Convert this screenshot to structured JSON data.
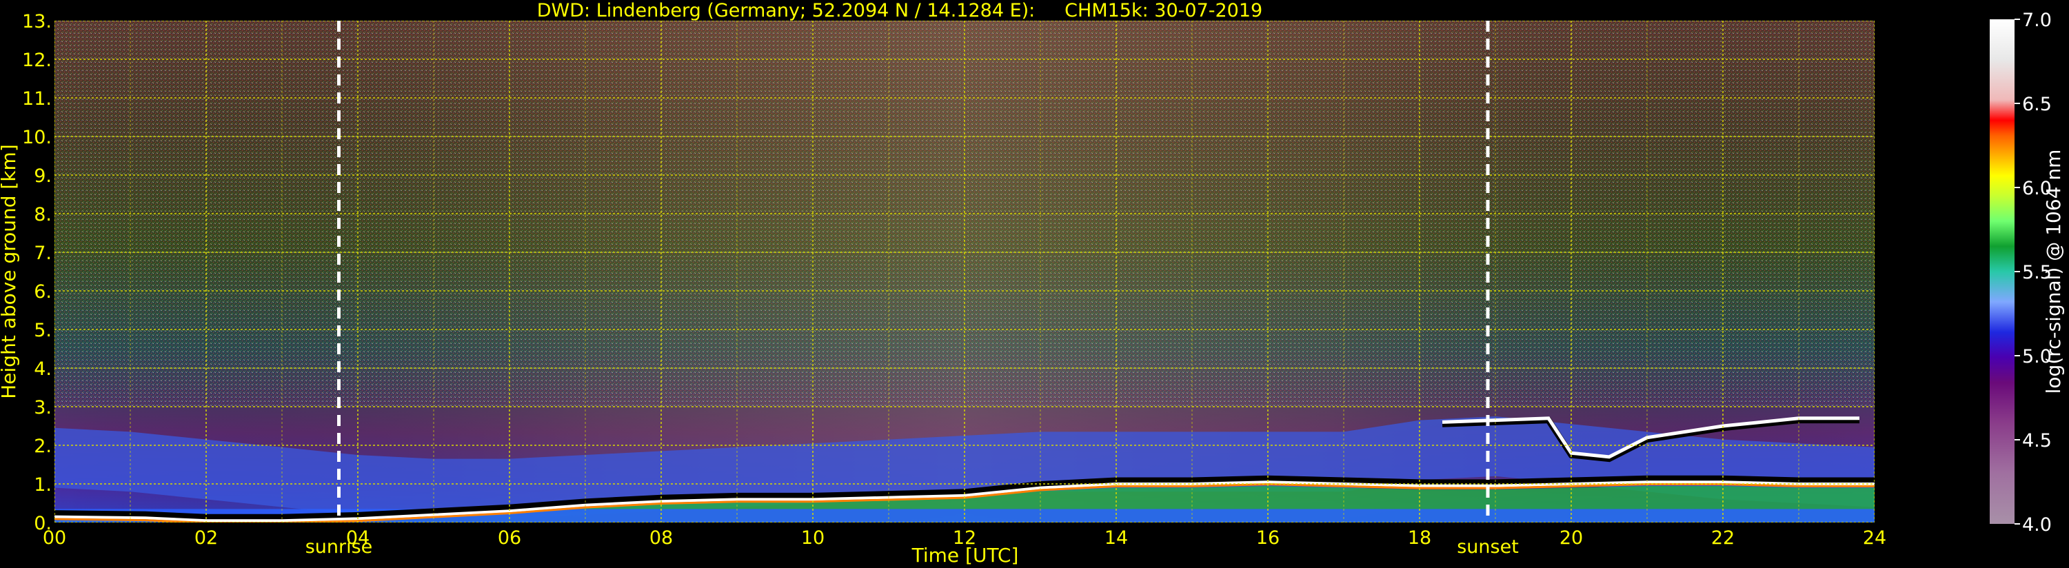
{
  "chart_data": {
    "type": "heatmap",
    "title": "DWD: Lindenberg (Germany; 52.2094 N / 14.1284 E):     CHM15k: 30-07-2019",
    "xlabel": "Time [UTC]",
    "ylabel": "Height above ground [km]",
    "xlim": [
      0,
      24
    ],
    "ylim": [
      0,
      13
    ],
    "x_ticks": [
      0,
      2,
      4,
      6,
      8,
      10,
      12,
      14,
      16,
      18,
      20,
      22,
      24
    ],
    "x_tick_labels": [
      "00",
      "02",
      "04",
      "06",
      "08",
      "10",
      "12",
      "14",
      "16",
      "18",
      "20",
      "22",
      "24"
    ],
    "y_ticks": [
      0,
      1,
      2,
      3,
      4,
      5,
      6,
      7,
      8,
      9,
      10,
      11,
      12,
      13
    ],
    "y_tick_labels": [
      "0.",
      "1.",
      "2.",
      "3.",
      "4.",
      "5.",
      "6.",
      "7.",
      "8.",
      "9.",
      "10.",
      "11.",
      "12.",
      "13."
    ],
    "grid": true,
    "annotations": [
      {
        "text": "sunrise",
        "x": 3.75
      },
      {
        "text": "sunset",
        "x": 18.9
      }
    ],
    "colorbar": {
      "label": "log(rc-signal) @ 1064 nm",
      "range": [
        4.0,
        7.0
      ],
      "ticks": [
        4.0,
        4.5,
        5.0,
        5.5,
        6.0,
        6.5,
        7.0
      ],
      "tick_labels": [
        "4.0",
        "4.5",
        "5.0",
        "5.5",
        "6.0",
        "6.5",
        "7.0"
      ],
      "colors": [
        "#a890a8",
        "#a070a0",
        "#8a3c8a",
        "#6a0a7a",
        "#4a00b0",
        "#1e28e0",
        "#4a78ff",
        "#80a8ff",
        "#28c8a8",
        "#10a030",
        "#30d050",
        "#70ff70",
        "#c8ff30",
        "#ffff00",
        "#ffb000",
        "#ff6000",
        "#ff0000",
        "#f0b8b8",
        "#e8e8e8",
        "#ffffff"
      ]
    },
    "layers": [
      {
        "name": "boundary_layer_top",
        "x": [
          0,
          1.2,
          2,
          3,
          4,
          5,
          6,
          7,
          8,
          9,
          10,
          11,
          12,
          13,
          14,
          15,
          16,
          17,
          18,
          19,
          20,
          21,
          22,
          23,
          24
        ],
        "y": [
          0.15,
          0.12,
          0.05,
          0.05,
          0.1,
          0.2,
          0.3,
          0.45,
          0.55,
          0.6,
          0.6,
          0.65,
          0.7,
          0.9,
          1.0,
          1.0,
          1.05,
          1.0,
          0.95,
          0.95,
          1.0,
          1.05,
          1.05,
          1.0,
          1.0
        ]
      },
      {
        "name": "residual_layer",
        "x": [
          0,
          1,
          2,
          3,
          4,
          5,
          6,
          7,
          8,
          9,
          10,
          11,
          12,
          13,
          14,
          15,
          16,
          17,
          18,
          19,
          20,
          21,
          22,
          23,
          24
        ],
        "y": [
          2.1,
          2.0,
          1.8,
          1.6,
          1.4,
          1.3,
          1.3,
          1.4,
          1.5,
          1.6,
          1.7,
          1.8,
          1.9,
          2.0,
          2.0,
          2.0,
          2.0,
          2.0,
          2.3,
          2.4,
          2.2,
          2.0,
          1.8,
          1.7,
          1.6
        ]
      },
      {
        "name": "cloud_layer",
        "x": [
          18.3,
          19,
          19.7,
          20,
          20.5,
          21,
          22,
          23,
          23.8
        ],
        "y": [
          2.6,
          2.65,
          2.7,
          1.8,
          1.7,
          2.2,
          2.5,
          2.7,
          2.7
        ]
      }
    ]
  }
}
